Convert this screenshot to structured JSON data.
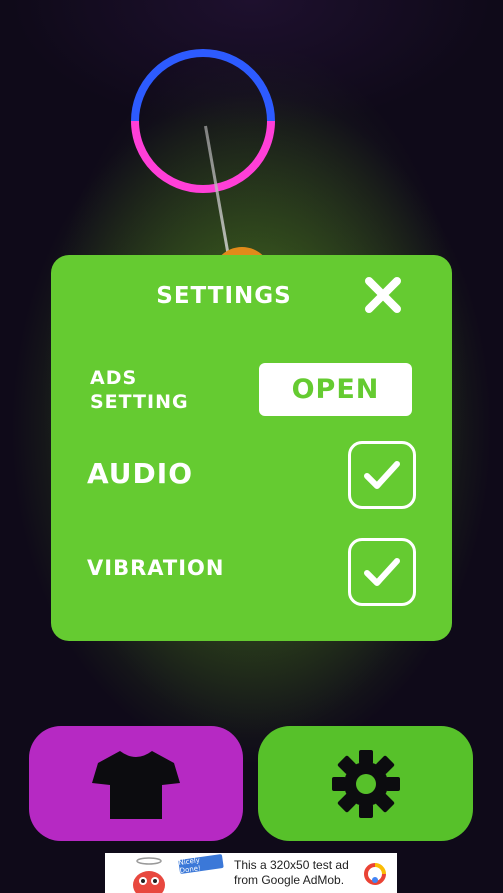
{
  "settings": {
    "title": "SETTINGS",
    "ads_setting_label_line1": "ADS",
    "ads_setting_label_line2": "SETTING",
    "open_label": "OPEN",
    "audio_label": "AUDIO",
    "vibration_label": "VIBRATION",
    "audio_checked": true,
    "vibration_checked": true
  },
  "bottom_bar": {
    "shop_icon": "tshirt-icon",
    "settings_icon": "gear-icon"
  },
  "ad_banner": {
    "flag_text": "Nicely Done!",
    "text": "This a 320x50 test ad from Google AdMob."
  },
  "colors": {
    "panel_green": "#65cb31",
    "shop_purple": "#b629c3",
    "settings_green": "#57c12a",
    "ring_blue": "#2d5bff",
    "ring_pink": "#ff3fd8"
  }
}
